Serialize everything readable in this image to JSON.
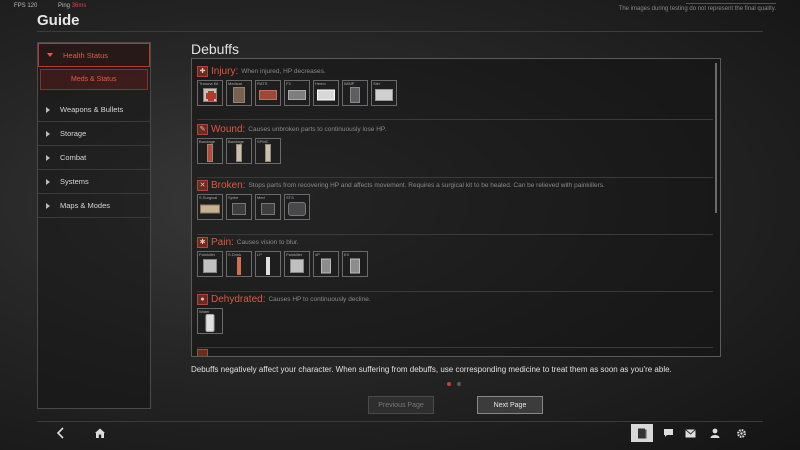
{
  "hud": {
    "fps_label": "FPS",
    "fps_value": "120",
    "ping_label": "Ping",
    "ping_value": "36ms"
  },
  "disclaimer": "The images during testing do not represent the final quality.",
  "page_title": "Guide",
  "sidebar": {
    "items": [
      {
        "label": "Health Status",
        "active": true,
        "sub": [
          {
            "label": "Meds & Status"
          }
        ]
      },
      {
        "label": "Weapons & Bullets"
      },
      {
        "label": "Storage"
      },
      {
        "label": "Combat"
      },
      {
        "label": "Systems"
      },
      {
        "label": "Maps & Modes"
      }
    ]
  },
  "section_title": "Debuffs",
  "debuffs": [
    {
      "name": "Injury:",
      "icon": "injury-icon",
      "desc": "When injured, HP decreases.",
      "items": [
        "Trauma Kit",
        "Medical",
        "RATS",
        "F3",
        "Hemo",
        "IMMP",
        "Ster"
      ]
    },
    {
      "name": "Wound:",
      "icon": "wound-icon",
      "desc": "Causes unbroken parts to continuously lose HP.",
      "items": [
        "Bandage",
        "Bandage",
        "SPMC"
      ]
    },
    {
      "name": "Broken:",
      "icon": "broken-icon",
      "desc": "Stops parts from recovering HP and affects movement. Requires a surgical kit to be healed. Can be relieved with painkillers.",
      "items": [
        "S.Surgical",
        "Splint",
        "Med",
        "STS"
      ]
    },
    {
      "name": "Pain:",
      "icon": "pain-icon",
      "desc": "Causes vision to blur.",
      "items": [
        "Painkiller",
        "S.Drink",
        "LP",
        "Painkiller",
        "4P",
        "EX"
      ]
    },
    {
      "name": "Dehydrated:",
      "icon": "dehydrated-icon",
      "desc": "Causes HP to continuously decline.",
      "items": [
        "Water"
      ]
    }
  ],
  "footer_text": "Debuffs negatively affect your character. When suffering from debuffs, use corresponding medicine to treat them as soon as you're able.",
  "pagination": {
    "prev_label": "Previous Page",
    "next_label": "Next Page"
  },
  "colors": {
    "accent": "#e4553f",
    "active_dot": "#d33c2c"
  }
}
